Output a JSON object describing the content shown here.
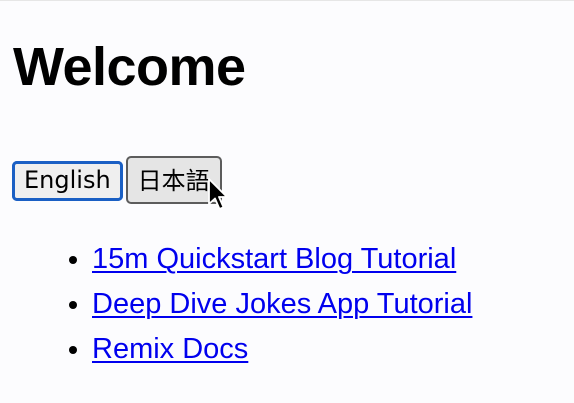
{
  "page": {
    "title": "Welcome"
  },
  "language_switcher": {
    "buttons": [
      {
        "label": "English",
        "state": "focused"
      },
      {
        "label": "日本語",
        "state": "hovered"
      }
    ],
    "focus_color": "#1a5fc4"
  },
  "links": {
    "items": [
      {
        "label": "15m Quickstart Blog Tutorial"
      },
      {
        "label": "Deep Dive Jokes App Tutorial"
      },
      {
        "label": "Remix Docs"
      }
    ],
    "link_color": "#0000ee"
  },
  "cursor": {
    "icon": "mouse-pointer-icon"
  }
}
